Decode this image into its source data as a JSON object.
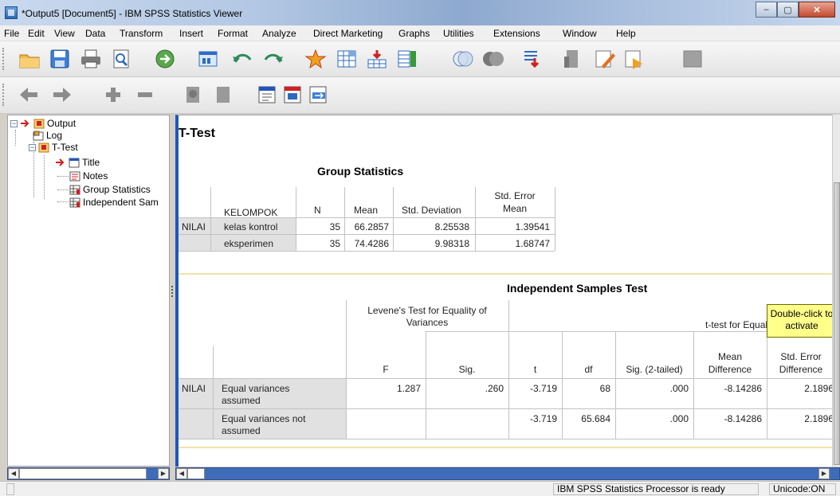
{
  "window": {
    "title": "*Output5 [Document5] - IBM SPSS Statistics Viewer",
    "minimize": "–",
    "maximize": "▢",
    "close": "✕"
  },
  "menu": [
    {
      "label": "File"
    },
    {
      "label": "Edit"
    },
    {
      "label": "View"
    },
    {
      "label": "Data"
    },
    {
      "label": "Transform"
    },
    {
      "label": "Insert"
    },
    {
      "label": "Format"
    },
    {
      "label": "Analyze"
    },
    {
      "label": "Direct Marketing"
    },
    {
      "label": "Graphs"
    },
    {
      "label": "Utilities"
    },
    {
      "label": "Extensions"
    },
    {
      "label": "Window"
    },
    {
      "label": "Help"
    }
  ],
  "toolbar1": [
    "open-icon",
    "save-icon",
    "print-icon",
    "print-preview-icon",
    "export-icon",
    "recall-dialog-icon",
    "undo-icon",
    "redo-icon",
    "goto-data-icon",
    "goto-case-icon",
    "goto-variable-icon",
    "variables-icon",
    "use-variable-sets-icon",
    "show-all-variables-icon",
    "spelling-icon",
    "designate-window-icon",
    "create-edit-icon",
    "run-script-icon",
    "inactive-icon"
  ],
  "toolbar2": [
    "back-icon",
    "forward-icon",
    "expand-icon",
    "collapse-icon",
    "show-icon",
    "hide-icon",
    "insert-heading-icon",
    "insert-title-icon",
    "insert-text-icon"
  ],
  "tree": {
    "root": "Output",
    "log": "Log",
    "ttest": "T-Test",
    "title": "Title",
    "notes": "Notes",
    "group_stats": "Group Statistics",
    "ind_samples": "Independent Sam",
    "expand_symbol": "−"
  },
  "output": {
    "heading": "T-Test",
    "group_statistics": {
      "title": "Group Statistics",
      "headers": {
        "group": "KELOMPOK",
        "n": "N",
        "mean": "Mean",
        "sd": "Std. Deviation",
        "se_line1": "Std. Error",
        "se_line2": "Mean"
      },
      "row_label": "NILAI",
      "rows": [
        {
          "group": "kelas kontrol",
          "n": "35",
          "mean": "66.2857",
          "sd": "8.25538",
          "se": "1.39541"
        },
        {
          "group": "eksperimen",
          "n": "35",
          "mean": "74.4286",
          "sd": "9.98318",
          "se": "1.68747"
        }
      ]
    },
    "independent_samples": {
      "title": "Independent Samples Test",
      "levene_line1": "Levene's Test for Equality of",
      "levene_line2": "Variances",
      "ttest_header": "t-test for Equali",
      "headers": {
        "f": "F",
        "sig": "Sig.",
        "t": "t",
        "df": "df",
        "sig2": "Sig. (2-tailed)",
        "md_line1": "Mean",
        "md_line2": "Difference",
        "se_line1": "Std. Error",
        "se_line2": "Difference"
      },
      "row_label": "NILAI",
      "rows": [
        {
          "label1": "Equal variances",
          "label2": "assumed",
          "f": "1.287",
          "sig": ".260",
          "t": "-3.719",
          "df": "68",
          "sig2": ".000",
          "md": "-8.14286",
          "se": "2.1896"
        },
        {
          "label1": "Equal variances not",
          "label2": "assumed",
          "f": "",
          "sig": "",
          "t": "-3.719",
          "df": "65.684",
          "sig2": ".000",
          "md": "-8.14286",
          "se": "2.1896"
        }
      ]
    },
    "tooltip_line1": "Double-click to",
    "tooltip_line2": "activate"
  },
  "statusbar": {
    "processor": "IBM SPSS Statistics Processor is ready",
    "unicode": "Unicode:ON"
  },
  "colors": {
    "accent": "#1f56c0",
    "tooltip": "#ffff8a",
    "row_shade": "#e1e1e1"
  }
}
